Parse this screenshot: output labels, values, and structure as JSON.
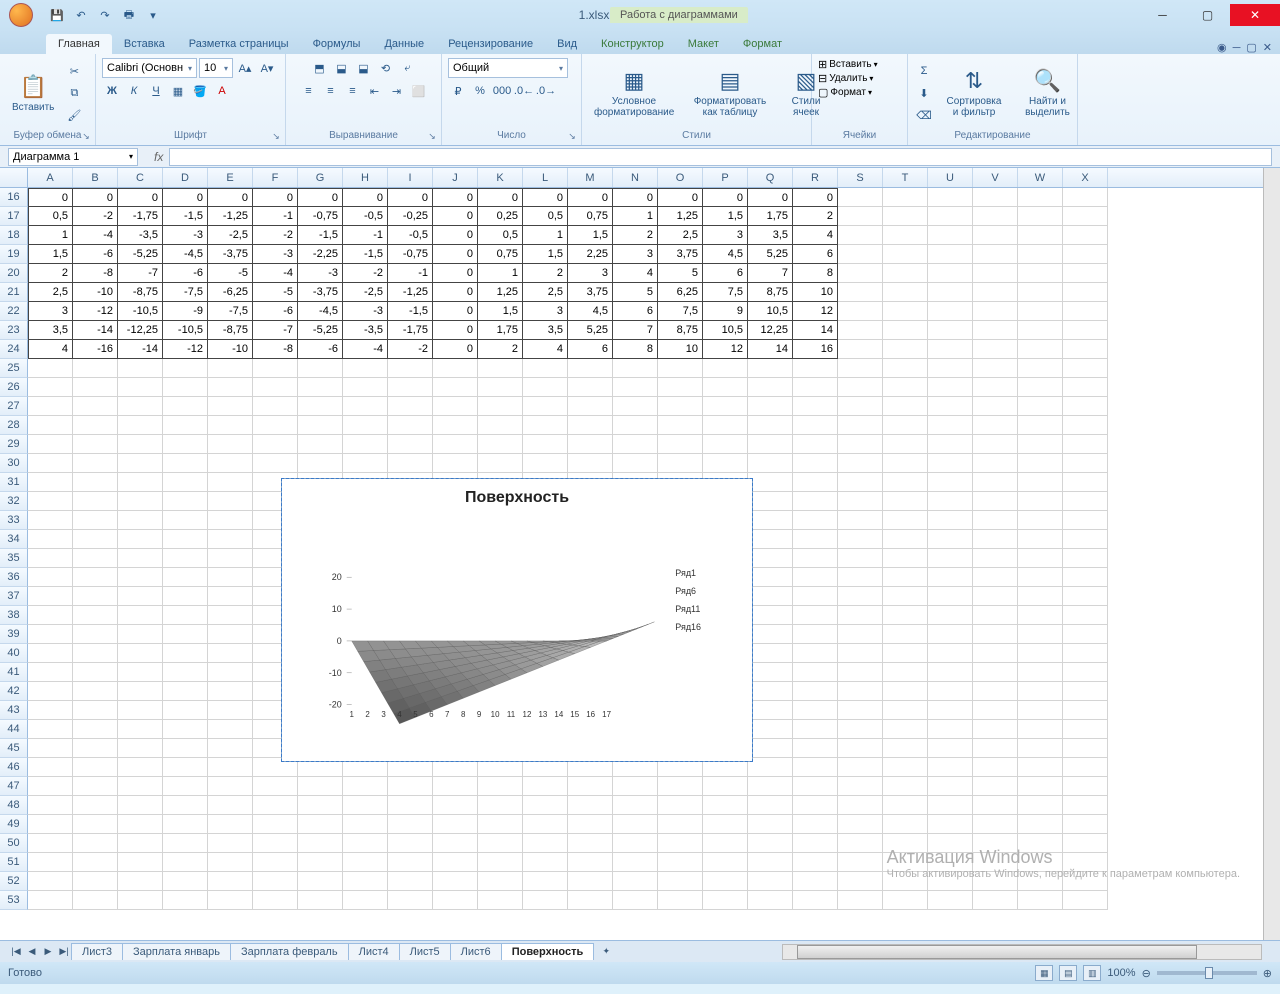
{
  "app": {
    "title": "1.xlsx - Microsoft Excel",
    "chart_tools": "Работа с диаграммами"
  },
  "qat": [
    "save",
    "undo",
    "redo",
    "print"
  ],
  "tabs": [
    "Главная",
    "Вставка",
    "Разметка страницы",
    "Формулы",
    "Данные",
    "Рецензирование",
    "Вид"
  ],
  "context_tabs": [
    "Конструктор",
    "Макет",
    "Формат"
  ],
  "ribbon": {
    "clipboard": {
      "title": "Буфер обмена",
      "paste": "Вставить"
    },
    "font": {
      "title": "Шрифт",
      "name": "Calibri (Основн",
      "size": "10",
      "bold": "Ж",
      "italic": "К",
      "underline": "Ч"
    },
    "align": {
      "title": "Выравнивание"
    },
    "number": {
      "title": "Число",
      "format": "Общий"
    },
    "styles": {
      "title": "Стили",
      "cond": "Условное форматирование",
      "table": "Форматировать как таблицу",
      "cell": "Стили ячеек"
    },
    "cells": {
      "title": "Ячейки",
      "insert": "Вставить",
      "delete": "Удалить",
      "format": "Формат"
    },
    "editing": {
      "title": "Редактирование",
      "sort": "Сортировка и фильтр",
      "find": "Найти и выделить"
    }
  },
  "namebox": "Диаграмма 1",
  "columns": [
    "A",
    "B",
    "C",
    "D",
    "E",
    "F",
    "G",
    "H",
    "I",
    "J",
    "K",
    "L",
    "M",
    "N",
    "O",
    "P",
    "Q",
    "R",
    "S",
    "T",
    "U",
    "V",
    "W",
    "X"
  ],
  "row_start": 16,
  "rows": [
    16,
    17,
    18,
    19,
    20,
    21,
    22,
    23,
    24,
    25,
    26,
    27,
    28,
    29,
    30,
    31,
    32,
    33,
    34,
    35,
    36,
    37,
    38,
    39,
    40,
    41,
    42,
    43,
    44,
    45,
    46,
    47,
    48,
    49,
    50,
    51,
    52,
    53
  ],
  "data": [
    [
      "0",
      "0",
      "0",
      "0",
      "0",
      "0",
      "0",
      "0",
      "0",
      "0",
      "0",
      "0",
      "0",
      "0",
      "0",
      "0",
      "0",
      "0"
    ],
    [
      "0,5",
      "-2",
      "-1,75",
      "-1,5",
      "-1,25",
      "-1",
      "-0,75",
      "-0,5",
      "-0,25",
      "0",
      "0,25",
      "0,5",
      "0,75",
      "1",
      "1,25",
      "1,5",
      "1,75",
      "2"
    ],
    [
      "1",
      "-4",
      "-3,5",
      "-3",
      "-2,5",
      "-2",
      "-1,5",
      "-1",
      "-0,5",
      "0",
      "0,5",
      "1",
      "1,5",
      "2",
      "2,5",
      "3",
      "3,5",
      "4"
    ],
    [
      "1,5",
      "-6",
      "-5,25",
      "-4,5",
      "-3,75",
      "-3",
      "-2,25",
      "-1,5",
      "-0,75",
      "0",
      "0,75",
      "1,5",
      "2,25",
      "3",
      "3,75",
      "4,5",
      "5,25",
      "6"
    ],
    [
      "2",
      "-8",
      "-7",
      "-6",
      "-5",
      "-4",
      "-3",
      "-2",
      "-1",
      "0",
      "1",
      "2",
      "3",
      "4",
      "5",
      "6",
      "7",
      "8"
    ],
    [
      "2,5",
      "-10",
      "-8,75",
      "-7,5",
      "-6,25",
      "-5",
      "-3,75",
      "-2,5",
      "-1,25",
      "0",
      "1,25",
      "2,5",
      "3,75",
      "5",
      "6,25",
      "7,5",
      "8,75",
      "10"
    ],
    [
      "3",
      "-12",
      "-10,5",
      "-9",
      "-7,5",
      "-6",
      "-4,5",
      "-3",
      "-1,5",
      "0",
      "1,5",
      "3",
      "4,5",
      "6",
      "7,5",
      "9",
      "10,5",
      "12"
    ],
    [
      "3,5",
      "-14",
      "-12,25",
      "-10,5",
      "-8,75",
      "-7",
      "-5,25",
      "-3,5",
      "-1,75",
      "0",
      "1,75",
      "3,5",
      "5,25",
      "7",
      "8,75",
      "10,5",
      "12,25",
      "14"
    ],
    [
      "4",
      "-16",
      "-14",
      "-12",
      "-10",
      "-8",
      "-6",
      "-4",
      "-2",
      "0",
      "2",
      "4",
      "6",
      "8",
      "10",
      "12",
      "14",
      "16"
    ]
  ],
  "sheet_tabs": [
    "Лист3",
    "Зарплата январь",
    "Зарплата февраль",
    "Лист4",
    "Лист5",
    "Лист6",
    "Поверхность"
  ],
  "active_sheet": "Поверхность",
  "status": "Готово",
  "zoom": "100%",
  "watermark": {
    "t1": "Активация Windows",
    "t2": "Чтобы активировать Windows, перейдите к параметрам компьютера."
  },
  "chart_data": {
    "type": "surface3d",
    "title": "Поверхность",
    "x_categories": [
      1,
      2,
      3,
      4,
      5,
      6,
      7,
      8,
      9,
      10,
      11,
      12,
      13,
      14,
      15,
      16,
      17
    ],
    "series_labels": [
      "Ряд1",
      "Ряд6",
      "Ряд11",
      "Ряд16"
    ],
    "z_ticks": [
      -20,
      -10,
      0,
      10,
      20
    ],
    "z_range": [
      -20,
      20
    ],
    "values": [
      [
        0,
        0,
        0,
        0,
        0,
        0,
        0,
        0,
        0,
        0,
        0,
        0,
        0,
        0,
        0,
        0,
        0
      ],
      [
        -2,
        -1.75,
        -1.5,
        -1.25,
        -1,
        -0.75,
        -0.5,
        -0.25,
        0,
        0.25,
        0.5,
        0.75,
        1,
        1.25,
        1.5,
        1.75,
        2
      ],
      [
        -4,
        -3.5,
        -3,
        -2.5,
        -2,
        -1.5,
        -1,
        -0.5,
        0,
        0.5,
        1,
        1.5,
        2,
        2.5,
        3,
        3.5,
        4
      ],
      [
        -6,
        -5.25,
        -4.5,
        -3.75,
        -3,
        -2.25,
        -1.5,
        -0.75,
        0,
        0.75,
        1.5,
        2.25,
        3,
        3.75,
        4.5,
        5.25,
        6
      ],
      [
        -8,
        -7,
        -6,
        -5,
        -4,
        -3,
        -2,
        -1,
        0,
        1,
        2,
        3,
        4,
        5,
        6,
        7,
        8
      ],
      [
        -10,
        -8.75,
        -7.5,
        -6.25,
        -5,
        -3.75,
        -2.5,
        -1.25,
        0,
        1.25,
        2.5,
        3.75,
        5,
        6.25,
        7.5,
        8.75,
        10
      ],
      [
        -12,
        -10.5,
        -9,
        -7.5,
        -6,
        -4.5,
        -3,
        -1.5,
        0,
        1.5,
        3,
        4.5,
        6,
        7.5,
        9,
        10.5,
        12
      ],
      [
        -14,
        -12.25,
        -10.5,
        -8.75,
        -7,
        -5.25,
        -3.5,
        -1.75,
        0,
        1.75,
        3.5,
        5.25,
        7,
        8.75,
        10.5,
        12.25,
        14
      ],
      [
        -16,
        -14,
        -12,
        -10,
        -8,
        -6,
        -4,
        -2,
        0,
        2,
        4,
        6,
        8,
        10,
        12,
        14,
        16
      ]
    ]
  }
}
